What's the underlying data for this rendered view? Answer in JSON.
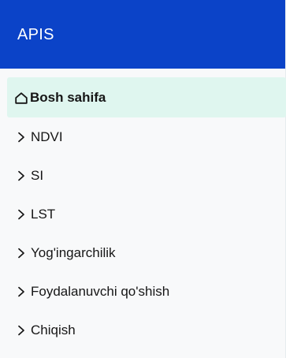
{
  "app": {
    "title": "APIS"
  },
  "sidebar": {
    "items": [
      {
        "label": "Bosh sahifa",
        "icon": "home-icon",
        "active": true
      },
      {
        "label": "NDVI",
        "icon": "chevron-right-icon"
      },
      {
        "label": "SI",
        "icon": "chevron-right-icon"
      },
      {
        "label": "LST",
        "icon": "chevron-right-icon"
      },
      {
        "label": "Yog'ingarchilik",
        "icon": "chevron-right-icon"
      },
      {
        "label": "Foydalanuvchi qo'shish",
        "icon": "chevron-right-icon"
      },
      {
        "label": "Chiqish",
        "icon": "chevron-right-icon"
      }
    ]
  },
  "colors": {
    "header": "#0b43c8",
    "active_background": "#dff6ef",
    "sidebar_background": "#f8f9fa",
    "text": "#161616"
  }
}
